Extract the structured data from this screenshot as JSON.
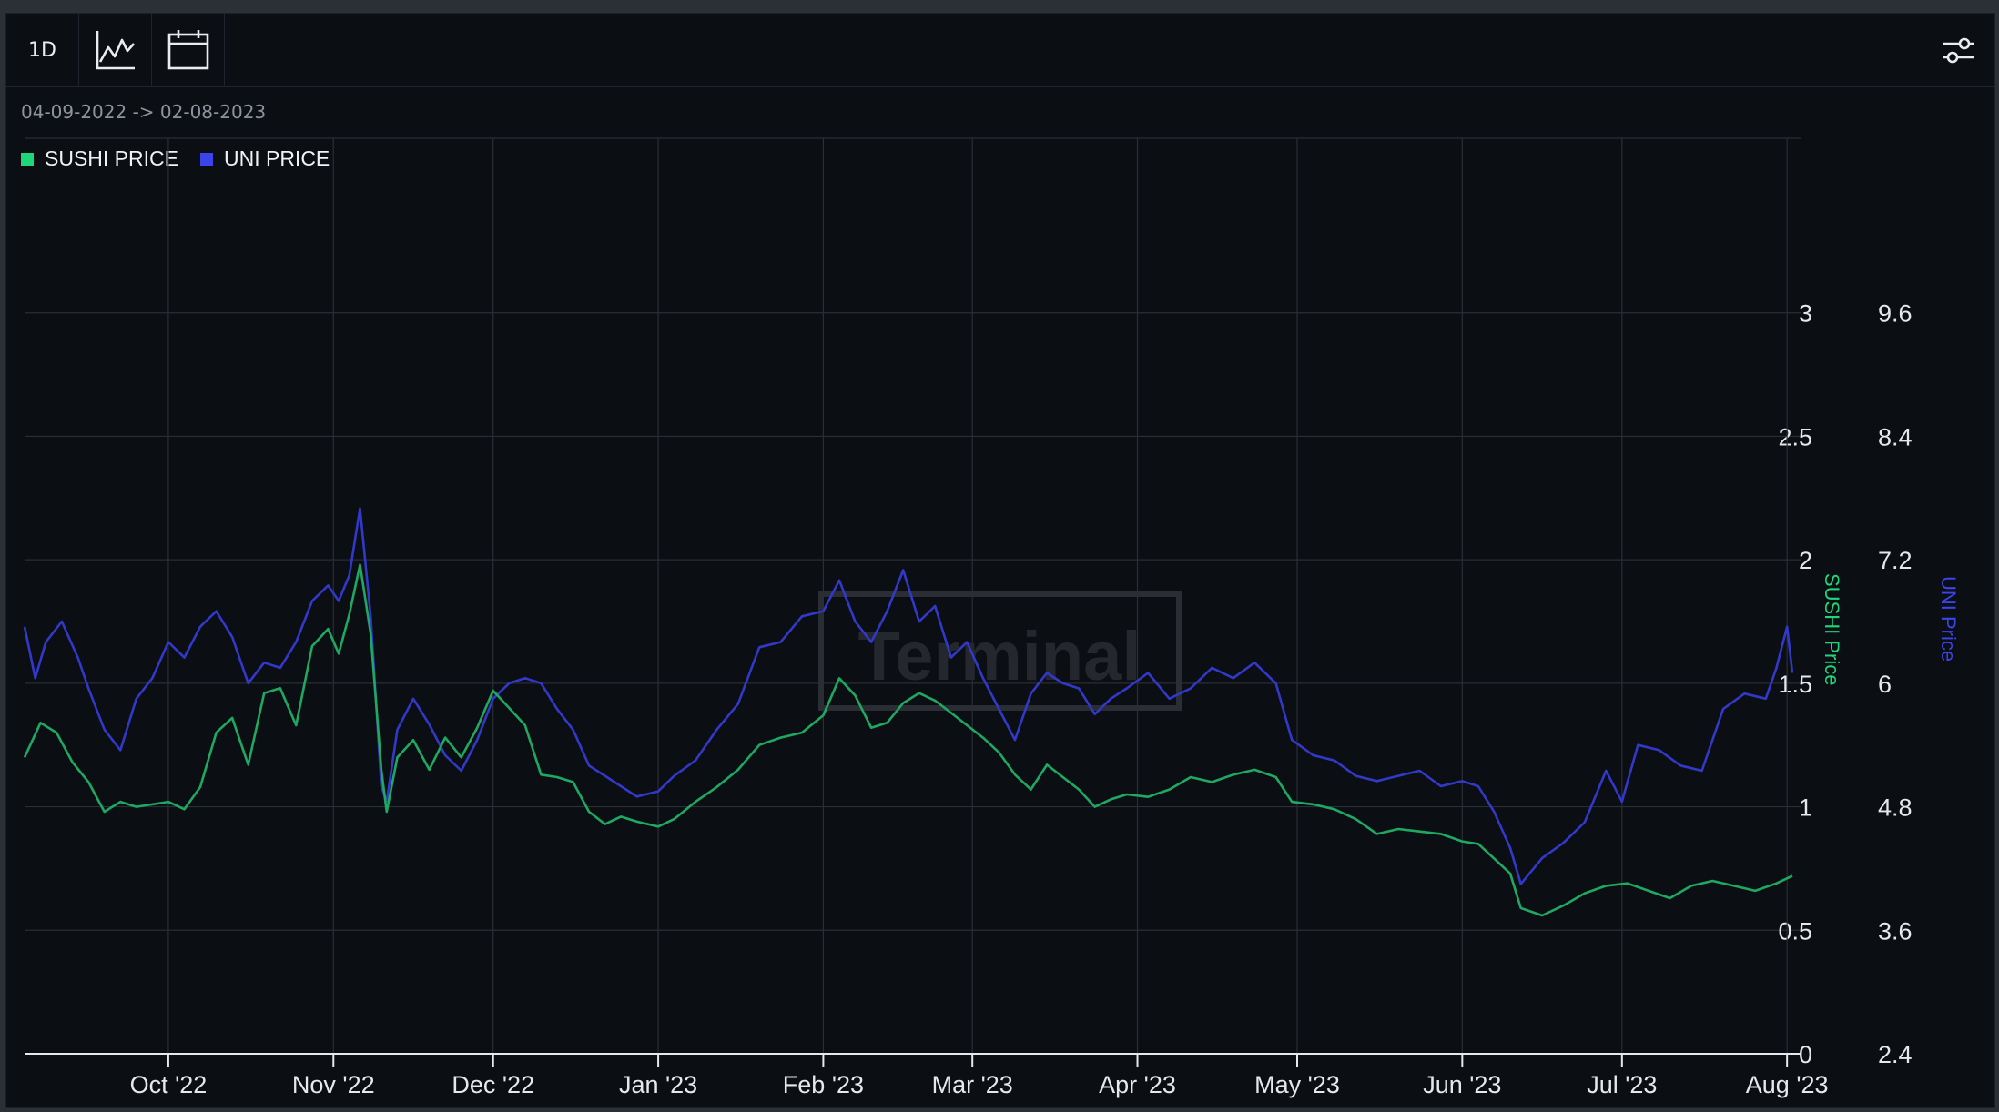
{
  "toolbar": {
    "interval_label": "1D",
    "chart_icon": "line-chart-icon",
    "calendar_icon": "calendar-icon",
    "settings_icon": "settings-sliders-icon"
  },
  "date_range": "04-09-2022 -> 02-08-2023",
  "legend": [
    {
      "label": "SUSHI PRICE",
      "color": "#1fd67b"
    },
    {
      "label": "UNI PRICE",
      "color": "#3b44e8"
    }
  ],
  "watermark": "Terminal",
  "colors": {
    "sushi": "#1fa862",
    "uni": "#3238c8",
    "background": "#0b0e13",
    "grid": "#2a2e35"
  },
  "chart_data": {
    "type": "line",
    "x_range": [
      "2022-09-04",
      "2023-08-02"
    ],
    "x_ticks": [
      {
        "label": "Oct '22",
        "date": "2022-10-01"
      },
      {
        "label": "Nov '22",
        "date": "2022-11-01"
      },
      {
        "label": "Dec '22",
        "date": "2022-12-01"
      },
      {
        "label": "Jan '23",
        "date": "2023-01-01"
      },
      {
        "label": "Feb '23",
        "date": "2023-02-01"
      },
      {
        "label": "Mar '23",
        "date": "2023-03-01"
      },
      {
        "label": "Apr '23",
        "date": "2023-04-01"
      },
      {
        "label": "May '23",
        "date": "2023-05-01"
      },
      {
        "label": "Jun '23",
        "date": "2023-06-01"
      },
      {
        "label": "Jul '23",
        "date": "2023-07-01"
      },
      {
        "label": "Aug '23",
        "date": "2023-08-01"
      }
    ],
    "y_left": {
      "label": "SUSHI Price",
      "ticks": [
        "0",
        "0.5",
        "1",
        "1.5",
        "2",
        "2.5",
        "3"
      ],
      "range": [
        0,
        3.5
      ]
    },
    "y_right": {
      "label": "UNI Price",
      "ticks": [
        "2.4",
        "3.6",
        "4.8",
        "6",
        "7.2",
        "8.4",
        "9.6"
      ],
      "range": [
        2.4,
        10.8
      ]
    },
    "series": [
      {
        "name": "SUSHI PRICE",
        "axis": "left",
        "points": [
          [
            "2022-09-04",
            1.2
          ],
          [
            "2022-09-07",
            1.34
          ],
          [
            "2022-09-10",
            1.3
          ],
          [
            "2022-09-13",
            1.18
          ],
          [
            "2022-09-16",
            1.1
          ],
          [
            "2022-09-19",
            0.98
          ],
          [
            "2022-09-22",
            1.02
          ],
          [
            "2022-09-25",
            1.0
          ],
          [
            "2022-09-28",
            1.01
          ],
          [
            "2022-10-01",
            1.02
          ],
          [
            "2022-10-04",
            0.99
          ],
          [
            "2022-10-07",
            1.08
          ],
          [
            "2022-10-10",
            1.3
          ],
          [
            "2022-10-13",
            1.36
          ],
          [
            "2022-10-16",
            1.17
          ],
          [
            "2022-10-19",
            1.46
          ],
          [
            "2022-10-22",
            1.48
          ],
          [
            "2022-10-25",
            1.33
          ],
          [
            "2022-10-28",
            1.65
          ],
          [
            "2022-10-31",
            1.72
          ],
          [
            "2022-11-02",
            1.62
          ],
          [
            "2022-11-04",
            1.78
          ],
          [
            "2022-11-06",
            1.98
          ],
          [
            "2022-11-08",
            1.7
          ],
          [
            "2022-11-10",
            1.15
          ],
          [
            "2022-11-11",
            0.98
          ],
          [
            "2022-11-13",
            1.2
          ],
          [
            "2022-11-16",
            1.27
          ],
          [
            "2022-11-19",
            1.15
          ],
          [
            "2022-11-22",
            1.28
          ],
          [
            "2022-11-25",
            1.2
          ],
          [
            "2022-11-28",
            1.32
          ],
          [
            "2022-12-01",
            1.47
          ],
          [
            "2022-12-04",
            1.4
          ],
          [
            "2022-12-07",
            1.33
          ],
          [
            "2022-12-10",
            1.13
          ],
          [
            "2022-12-13",
            1.12
          ],
          [
            "2022-12-16",
            1.1
          ],
          [
            "2022-12-19",
            0.98
          ],
          [
            "2022-12-22",
            0.93
          ],
          [
            "2022-12-25",
            0.96
          ],
          [
            "2022-12-28",
            0.94
          ],
          [
            "2023-01-01",
            0.92
          ],
          [
            "2023-01-04",
            0.95
          ],
          [
            "2023-01-08",
            1.02
          ],
          [
            "2023-01-12",
            1.08
          ],
          [
            "2023-01-16",
            1.15
          ],
          [
            "2023-01-20",
            1.25
          ],
          [
            "2023-01-24",
            1.28
          ],
          [
            "2023-01-28",
            1.3
          ],
          [
            "2023-02-01",
            1.37
          ],
          [
            "2023-02-04",
            1.52
          ],
          [
            "2023-02-07",
            1.45
          ],
          [
            "2023-02-10",
            1.32
          ],
          [
            "2023-02-13",
            1.34
          ],
          [
            "2023-02-16",
            1.42
          ],
          [
            "2023-02-19",
            1.46
          ],
          [
            "2023-02-22",
            1.43
          ],
          [
            "2023-02-25",
            1.38
          ],
          [
            "2023-02-28",
            1.33
          ],
          [
            "2023-03-03",
            1.28
          ],
          [
            "2023-03-06",
            1.22
          ],
          [
            "2023-03-09",
            1.13
          ],
          [
            "2023-03-12",
            1.07
          ],
          [
            "2023-03-15",
            1.17
          ],
          [
            "2023-03-18",
            1.12
          ],
          [
            "2023-03-21",
            1.07
          ],
          [
            "2023-03-24",
            1.0
          ],
          [
            "2023-03-27",
            1.03
          ],
          [
            "2023-03-30",
            1.05
          ],
          [
            "2023-04-03",
            1.04
          ],
          [
            "2023-04-07",
            1.07
          ],
          [
            "2023-04-11",
            1.12
          ],
          [
            "2023-04-15",
            1.1
          ],
          [
            "2023-04-19",
            1.13
          ],
          [
            "2023-04-23",
            1.15
          ],
          [
            "2023-04-27",
            1.12
          ],
          [
            "2023-04-30",
            1.02
          ],
          [
            "2023-05-04",
            1.01
          ],
          [
            "2023-05-08",
            0.99
          ],
          [
            "2023-05-12",
            0.95
          ],
          [
            "2023-05-16",
            0.89
          ],
          [
            "2023-05-20",
            0.91
          ],
          [
            "2023-05-24",
            0.9
          ],
          [
            "2023-05-28",
            0.89
          ],
          [
            "2023-06-01",
            0.86
          ],
          [
            "2023-06-04",
            0.85
          ],
          [
            "2023-06-07",
            0.79
          ],
          [
            "2023-06-10",
            0.73
          ],
          [
            "2023-06-12",
            0.59
          ],
          [
            "2023-06-16",
            0.56
          ],
          [
            "2023-06-20",
            0.6
          ],
          [
            "2023-06-24",
            0.65
          ],
          [
            "2023-06-28",
            0.68
          ],
          [
            "2023-07-02",
            0.69
          ],
          [
            "2023-07-06",
            0.66
          ],
          [
            "2023-07-10",
            0.63
          ],
          [
            "2023-07-14",
            0.68
          ],
          [
            "2023-07-18",
            0.7
          ],
          [
            "2023-07-22",
            0.68
          ],
          [
            "2023-07-26",
            0.66
          ],
          [
            "2023-07-30",
            0.69
          ],
          [
            "2023-08-02",
            0.72
          ]
        ]
      },
      {
        "name": "UNI PRICE",
        "axis": "right",
        "points": [
          [
            "2022-09-04",
            6.55
          ],
          [
            "2022-09-06",
            6.05
          ],
          [
            "2022-09-08",
            6.4
          ],
          [
            "2022-09-11",
            6.6
          ],
          [
            "2022-09-14",
            6.25
          ],
          [
            "2022-09-16",
            5.95
          ],
          [
            "2022-09-19",
            5.55
          ],
          [
            "2022-09-22",
            5.35
          ],
          [
            "2022-09-25",
            5.85
          ],
          [
            "2022-09-28",
            6.05
          ],
          [
            "2022-10-01",
            6.4
          ],
          [
            "2022-10-04",
            6.25
          ],
          [
            "2022-10-07",
            6.55
          ],
          [
            "2022-10-10",
            6.7
          ],
          [
            "2022-10-13",
            6.45
          ],
          [
            "2022-10-16",
            6.0
          ],
          [
            "2022-10-19",
            6.2
          ],
          [
            "2022-10-22",
            6.15
          ],
          [
            "2022-10-25",
            6.4
          ],
          [
            "2022-10-28",
            6.8
          ],
          [
            "2022-10-31",
            6.95
          ],
          [
            "2022-11-02",
            6.8
          ],
          [
            "2022-11-04",
            7.05
          ],
          [
            "2022-11-06",
            7.7
          ],
          [
            "2022-11-08",
            6.65
          ],
          [
            "2022-11-10",
            5.0
          ],
          [
            "2022-11-11",
            4.85
          ],
          [
            "2022-11-13",
            5.55
          ],
          [
            "2022-11-16",
            5.85
          ],
          [
            "2022-11-19",
            5.6
          ],
          [
            "2022-11-22",
            5.3
          ],
          [
            "2022-11-25",
            5.15
          ],
          [
            "2022-11-28",
            5.45
          ],
          [
            "2022-12-01",
            5.85
          ],
          [
            "2022-12-04",
            6.0
          ],
          [
            "2022-12-07",
            6.05
          ],
          [
            "2022-12-10",
            6.0
          ],
          [
            "2022-12-13",
            5.75
          ],
          [
            "2022-12-16",
            5.55
          ],
          [
            "2022-12-19",
            5.2
          ],
          [
            "2022-12-22",
            5.1
          ],
          [
            "2022-12-25",
            5.0
          ],
          [
            "2022-12-28",
            4.9
          ],
          [
            "2023-01-01",
            4.95
          ],
          [
            "2023-01-04",
            5.1
          ],
          [
            "2023-01-08",
            5.25
          ],
          [
            "2023-01-12",
            5.55
          ],
          [
            "2023-01-16",
            5.8
          ],
          [
            "2023-01-20",
            6.35
          ],
          [
            "2023-01-24",
            6.4
          ],
          [
            "2023-01-28",
            6.65
          ],
          [
            "2023-02-01",
            6.7
          ],
          [
            "2023-02-04",
            7.0
          ],
          [
            "2023-02-07",
            6.6
          ],
          [
            "2023-02-10",
            6.4
          ],
          [
            "2023-02-13",
            6.7
          ],
          [
            "2023-02-16",
            7.1
          ],
          [
            "2023-02-19",
            6.6
          ],
          [
            "2023-02-22",
            6.75
          ],
          [
            "2023-02-25",
            6.25
          ],
          [
            "2023-02-28",
            6.4
          ],
          [
            "2023-03-03",
            6.05
          ],
          [
            "2023-03-06",
            5.75
          ],
          [
            "2023-03-09",
            5.45
          ],
          [
            "2023-03-12",
            5.9
          ],
          [
            "2023-03-15",
            6.1
          ],
          [
            "2023-03-18",
            6.0
          ],
          [
            "2023-03-21",
            5.95
          ],
          [
            "2023-03-24",
            5.7
          ],
          [
            "2023-03-27",
            5.85
          ],
          [
            "2023-03-30",
            5.95
          ],
          [
            "2023-04-03",
            6.1
          ],
          [
            "2023-04-07",
            5.85
          ],
          [
            "2023-04-11",
            5.95
          ],
          [
            "2023-04-15",
            6.15
          ],
          [
            "2023-04-19",
            6.05
          ],
          [
            "2023-04-23",
            6.2
          ],
          [
            "2023-04-27",
            6.0
          ],
          [
            "2023-04-30",
            5.45
          ],
          [
            "2023-05-04",
            5.3
          ],
          [
            "2023-05-08",
            5.25
          ],
          [
            "2023-05-12",
            5.1
          ],
          [
            "2023-05-16",
            5.05
          ],
          [
            "2023-05-20",
            5.1
          ],
          [
            "2023-05-24",
            5.15
          ],
          [
            "2023-05-28",
            5.0
          ],
          [
            "2023-06-01",
            5.05
          ],
          [
            "2023-06-04",
            5.0
          ],
          [
            "2023-06-07",
            4.75
          ],
          [
            "2023-06-10",
            4.4
          ],
          [
            "2023-06-12",
            4.05
          ],
          [
            "2023-06-16",
            4.3
          ],
          [
            "2023-06-20",
            4.45
          ],
          [
            "2023-06-24",
            4.65
          ],
          [
            "2023-06-28",
            5.15
          ],
          [
            "2023-07-01",
            4.85
          ],
          [
            "2023-07-04",
            5.4
          ],
          [
            "2023-07-08",
            5.35
          ],
          [
            "2023-07-12",
            5.2
          ],
          [
            "2023-07-16",
            5.15
          ],
          [
            "2023-07-20",
            5.75
          ],
          [
            "2023-07-24",
            5.9
          ],
          [
            "2023-07-28",
            5.85
          ],
          [
            "2023-07-30",
            6.15
          ],
          [
            "2023-08-01",
            6.55
          ],
          [
            "2023-08-02",
            6.1
          ]
        ]
      }
    ]
  }
}
